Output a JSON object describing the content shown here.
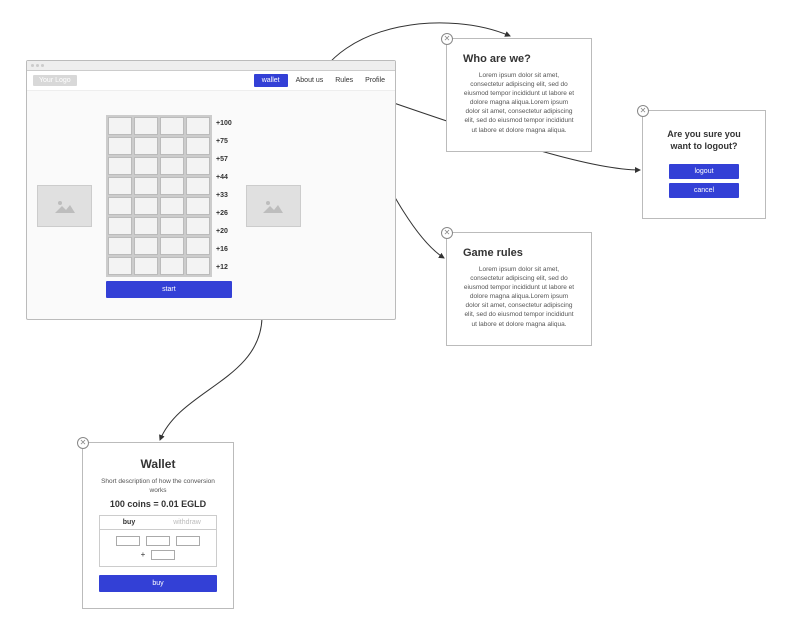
{
  "main": {
    "logo_text": "Your Logo",
    "nav": {
      "wallet": "wallet",
      "about": "About us",
      "rules": "Rules",
      "profile": "Profile"
    },
    "row_values": [
      "+100",
      "+75",
      "+57",
      "+44",
      "+33",
      "+26",
      "+20",
      "+16",
      "+12"
    ],
    "start": "start"
  },
  "who": {
    "title": "Who are we?",
    "body": "Lorem ipsum dolor sit amet, consectetur adipiscing elit, sed do eiusmod tempor incididunt ut labore et dolore magna aliqua.Lorem ipsum dolor sit amet, consectetur adipiscing elit, sed do eiusmod tempor incididunt ut labore et dolore magna aliqua."
  },
  "rules": {
    "title": "Game rules",
    "body": "Lorem ipsum dolor sit amet, consectetur adipiscing elit, sed do eiusmod tempor incididunt ut labore et dolore magna aliqua.Lorem ipsum dolor sit amet, consectetur adipiscing elit, sed do eiusmod tempor incididunt ut labore et dolore magna aliqua."
  },
  "logout": {
    "prompt": "Are you sure you want to logout?",
    "confirm": "logout",
    "cancel": "cancel"
  },
  "wallet": {
    "title": "Wallet",
    "desc": "Short description of how the conversion works",
    "rate": "100 coins = 0.01 EGLD",
    "tab_buy": "buy",
    "tab_withdraw": "withdraw",
    "plus": "+",
    "buy_btn": "buy"
  }
}
